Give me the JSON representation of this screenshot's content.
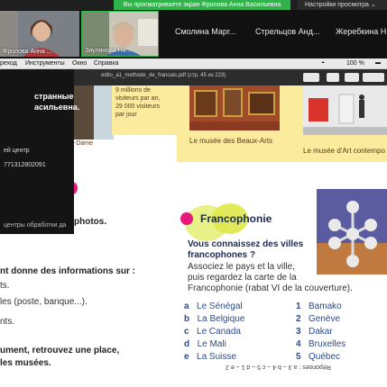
{
  "zoom": {
    "share_banner": "Вы просматриваете экран Фролова Анна Васильевна",
    "view_settings": "Настройки просмотра ⌄",
    "thumbnails": [
      {
        "label": "Фролова Анна ..."
      },
      {
        "label": "Зиулянова Ни..."
      }
    ],
    "participants": [
      "Смолина Марг...",
      "Стрельцов Анд...",
      "Жеребкина Н..."
    ]
  },
  "menubar": {
    "items": [
      "реход",
      "Инструменты",
      "Окно",
      "Справка"
    ],
    "status": "100 %"
  },
  "pdf": {
    "filename": "edito_a1_methode_de_francais.pdf (стр. 45 из 223)"
  },
  "chat": {
    "title_line1": "странные",
    "title_line2": "асильевна.",
    "line3": "ей центр",
    "line4": "771312802091",
    "line5": "центры обработки да"
  },
  "page": {
    "visitors_text": [
      "9 millions de",
      "visiteurs par an,",
      "29 000 visiteurs",
      "par jour"
    ],
    "dame_text": "-Dame",
    "beaux_arts": "Le musée des Beaux-Arts",
    "art_contemp": "Le musée d'Art contempo",
    "left_lines": [
      {
        "text": "photos.",
        "bold": true
      },
      {
        "text": "nt donne des informations sur :",
        "bold": true
      },
      {
        "text": "ts.",
        "bold": false
      },
      {
        "text": "les (poste, banque...).",
        "bold": false
      },
      {
        "text": "nts.",
        "bold": false
      },
      {
        "text": "ument, retrouvez une place,",
        "bold": true
      },
      {
        "text": "les musées.",
        "bold": true
      }
    ],
    "section_title": "Francophonie",
    "question_line1": "Vous connaissez des villes",
    "question_line2": "francophones ?",
    "instruction_line1": "Associez le pays et la ville,",
    "instruction_line2": "puis regardez la carte de la",
    "instruction_line3": "Francophonie (rabat VI de la couverture).",
    "countries": [
      {
        "letter": "a",
        "name": "Le Sénégal"
      },
      {
        "letter": "b",
        "name": "La Belgique"
      },
      {
        "letter": "c",
        "name": "Le Canada"
      },
      {
        "letter": "d",
        "name": "Le Mali"
      },
      {
        "letter": "e",
        "name": "La Suisse"
      }
    ],
    "cities": [
      {
        "num": "1",
        "name": "Bamako"
      },
      {
        "num": "2",
        "name": "Genève"
      },
      {
        "num": "3",
        "name": "Dakar"
      },
      {
        "num": "4",
        "name": "Bruxelles"
      },
      {
        "num": "5",
        "name": "Québec"
      }
    ],
    "answers": "Réponses : a 3 – b 4 – c 5 – d 1 – e 2"
  },
  "colors": {
    "accent_green": "#2fb34a",
    "pink": "#e8197a",
    "yellow": "#fbeb9c",
    "lime": "#d8ea3a"
  }
}
